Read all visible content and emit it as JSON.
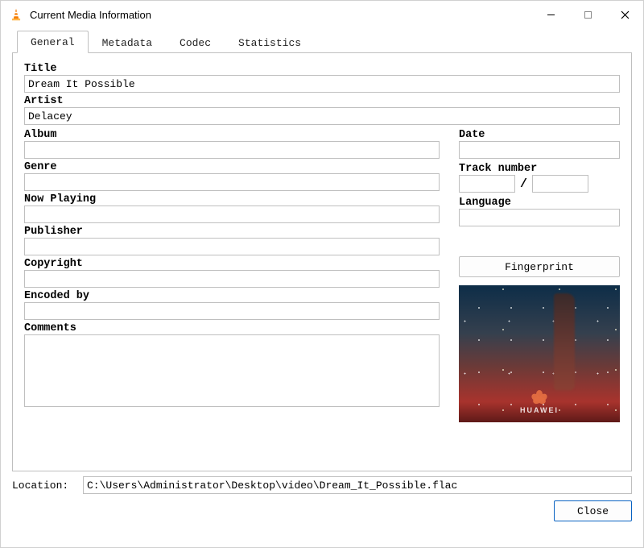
{
  "window": {
    "title": "Current Media Information"
  },
  "tabs": {
    "general": "General",
    "metadata": "Metadata",
    "codec": "Codec",
    "statistics": "Statistics"
  },
  "labels": {
    "title": "Title",
    "artist": "Artist",
    "album": "Album",
    "date": "Date",
    "genre": "Genre",
    "track_number": "Track number",
    "track_sep": "/",
    "now_playing": "Now Playing",
    "language": "Language",
    "publisher": "Publisher",
    "copyright": "Copyright",
    "encoded_by": "Encoded by",
    "comments": "Comments",
    "location": "Location:"
  },
  "values": {
    "title": "Dream It Possible",
    "artist": "Delacey",
    "album": "",
    "date": "",
    "genre": "",
    "track_a": "",
    "track_b": "",
    "now_playing": "",
    "language": "",
    "publisher": "",
    "copyright": "",
    "encoded_by": "",
    "comments": "",
    "location": "C:\\Users\\Administrator\\Desktop\\video\\Dream_It_Possible.flac"
  },
  "buttons": {
    "fingerprint": "Fingerprint",
    "close": "Close"
  },
  "icons": {
    "app": "vlc-cone-icon",
    "minimize": "minimize-icon",
    "maximize": "maximize-icon",
    "close": "close-icon"
  },
  "cover_art": {
    "brand_text": "HUAWEI"
  }
}
